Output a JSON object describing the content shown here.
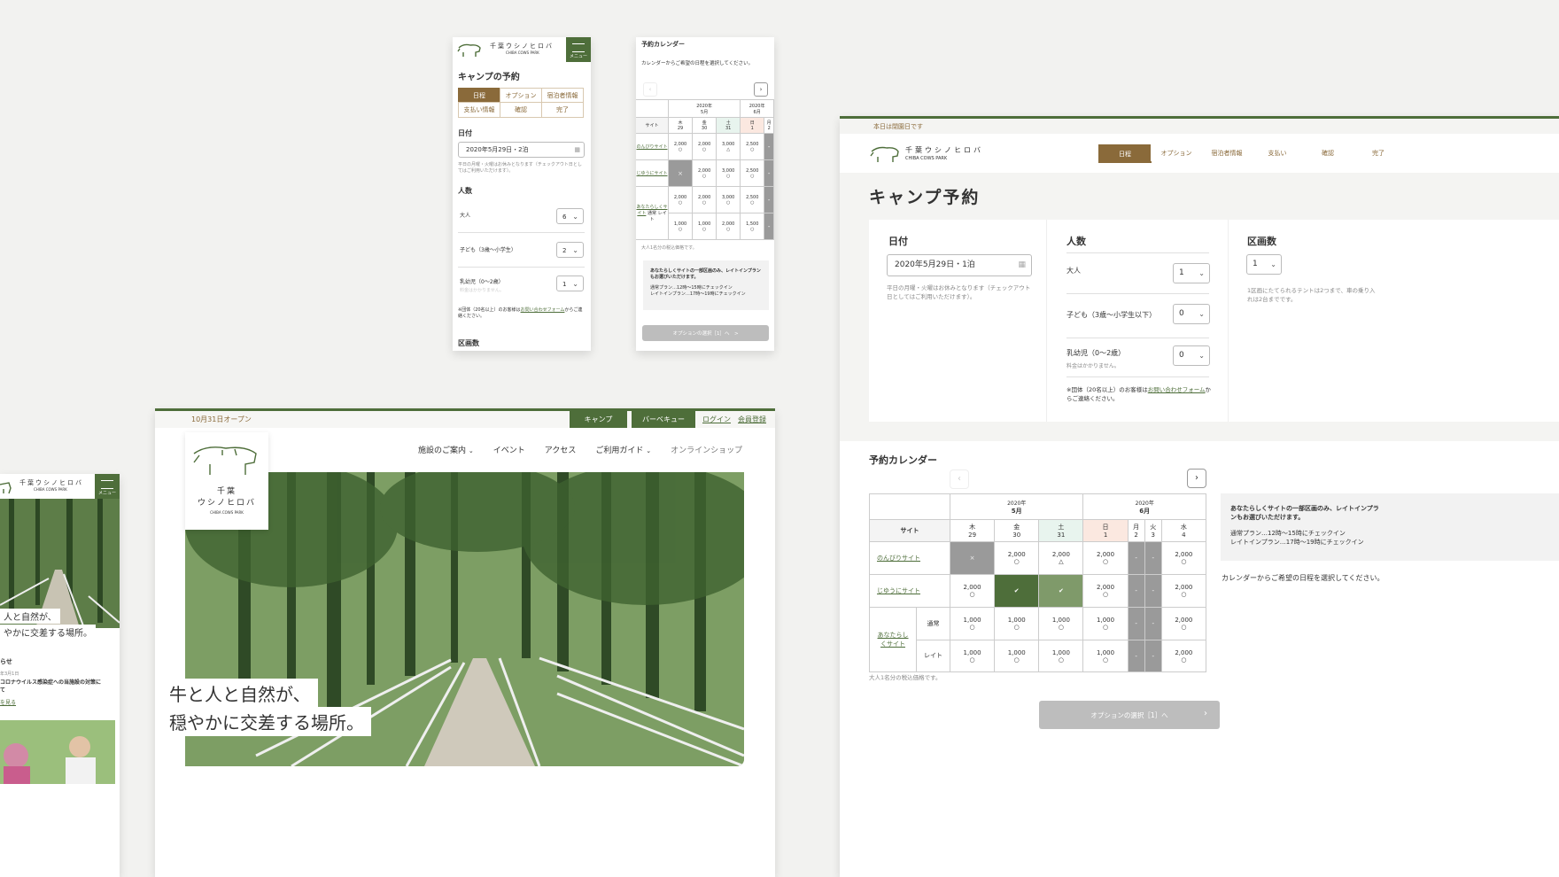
{
  "brand": {
    "name_ja": "千葉ウシノヒロバ",
    "name_en": "CHIBA COWS PARK",
    "name_ja_stacked": [
      "千葉",
      "ウシノヒロバ"
    ],
    "menu_label": "メニュー"
  },
  "mobile_form": {
    "title": "キャンプの予約",
    "steps": [
      "日程",
      "オプション",
      "宿泊者情報",
      "支払い情報",
      "確認",
      "完了"
    ],
    "date_label": "日付",
    "date_value": "2020年5月29日・2泊",
    "date_note": "平日の月曜・火曜はお休みとなります（チェックアウト日としてはご利用いただけます）。",
    "people_label": "人数",
    "adult_label": "大人",
    "adult_value": "6",
    "child_label": "子ども（3歳〜小学生）",
    "child_value": "2",
    "infant_label": "乳幼児（0〜2歳）",
    "infant_value": "1",
    "infant_note": "料金はかかりません。",
    "group_note_pre": "※団体（20名以上）のお客様は",
    "group_note_link": "お問い合わせフォーム",
    "group_note_post": "からご連絡ください。",
    "section_label": "区画数"
  },
  "mobile_calendar": {
    "title": "予約カレンダー",
    "instruction": "カレンダーからご希望の日程を選択してください。",
    "month1": "2020年\n5月",
    "month2": "2020年\n6月",
    "site_header": "サイト",
    "days": [
      {
        "w": "木",
        "d": "29"
      },
      {
        "w": "金",
        "d": "30"
      },
      {
        "w": "土",
        "d": "31"
      },
      {
        "w": "日",
        "d": "1"
      },
      {
        "w": "月",
        "d": "2"
      }
    ],
    "rows": [
      "のんびりサイト",
      "じゆうにサイト",
      "あなたらしくサイト",
      "通常",
      "レイト"
    ],
    "price_note": "大人1名分の税込価格です。",
    "info_title": "あなたらしくサイトの一部区画のみ、レイトインプランもお選びいただけます。",
    "info_line1": "通常プラン…12時〜15時にチェックイン",
    "info_line2": "レイトインプラン…17時〜19時にチェックイン",
    "next_button": "オプションの選択［1］へ　>"
  },
  "homepage": {
    "open_notice": "10月31日オープン",
    "top_buttons": [
      "キャンプ",
      "バーベキュー"
    ],
    "login": "ログイン",
    "member": "会員登録",
    "nav": [
      "施設のご案内",
      "イベント",
      "アクセス",
      "ご利用ガイド",
      "オンラインショップ"
    ],
    "hero_line1": "牛と人と自然が、",
    "hero_line2": "穏やかに交差する場所。"
  },
  "left_mobile": {
    "hero_line1": "人と自然が、",
    "hero_line2": "やかに交差する場所。",
    "news_label": "らせ",
    "news_date": "年3月1日",
    "news_title": "コロナウイルス感染症への当施設の対策に",
    "news_title2": "て",
    "news_link": "を見る"
  },
  "desktop": {
    "notice": "本日は閉園日です",
    "steps": [
      "日程",
      "オプション",
      "宿泊者情報",
      "支払い",
      "確認",
      "完了"
    ],
    "title": "キャンプ予約",
    "date_label": "日付",
    "date_value": "2020年5月29日・1泊",
    "date_note": "平日の月曜・火曜はお休みとなります（チェックアウト日としてはご利用いただけます）。",
    "people_label": "人数",
    "adult_label": "大人",
    "adult_value": "1",
    "child_label": "子ども（3歳〜小学生以下）",
    "child_value": "0",
    "infant_label": "乳幼児（0〜2歳）",
    "infant_value": "0",
    "infant_note": "料金はかかりません。",
    "group_note_pre": "※団体（20名以上）のお客様は",
    "group_note_link": "お問い合わせフォーム",
    "group_note_post": "からご連絡ください。",
    "section_label": "区画数",
    "section_value": "1",
    "section_note": "1区画にたてられるテントは2つまで、車の乗り入れは2台までです。",
    "calendar_title": "予約カレンダー",
    "month1": "2020年",
    "month1b": "5月",
    "month2": "2020年",
    "month2b": "6月",
    "site_header": "サイト",
    "days": [
      {
        "w": "木",
        "d": "29"
      },
      {
        "w": "金",
        "d": "30"
      },
      {
        "w": "土",
        "d": "31"
      },
      {
        "w": "日",
        "d": "1"
      },
      {
        "w": "月",
        "d": "2"
      },
      {
        "w": "火",
        "d": "3"
      },
      {
        "w": "水",
        "d": "4"
      }
    ],
    "row1": "のんびりサイト",
    "row2": "じゆうにサイト",
    "row3": "あなたらしくサイト",
    "sub1": "通常",
    "sub2": "レイト",
    "price_note": "大人1名分の税込価格です。",
    "info_title": "あなたらしくサイトの一部区画のみ、レイトインプランもお選びいただけます。",
    "info_line1": "通常プラン…12時〜15時にチェックイン",
    "info_line2": "レイトインプラン…17時〜19時にチェックイン",
    "instruction": "カレンダーからご希望の日程を選択してください。",
    "next_button": "オプションの選択［1］へ",
    "prices": {
      "p2000": "2,000",
      "p2500": "2,500",
      "p3000": "3,000",
      "p1000": "1,000",
      "p1500": "1,500"
    },
    "dash": "-"
  },
  "colors": {
    "brand_green": "#4e6e3a",
    "brown": "#8a6a3a",
    "bg": "#f2f2f0"
  }
}
